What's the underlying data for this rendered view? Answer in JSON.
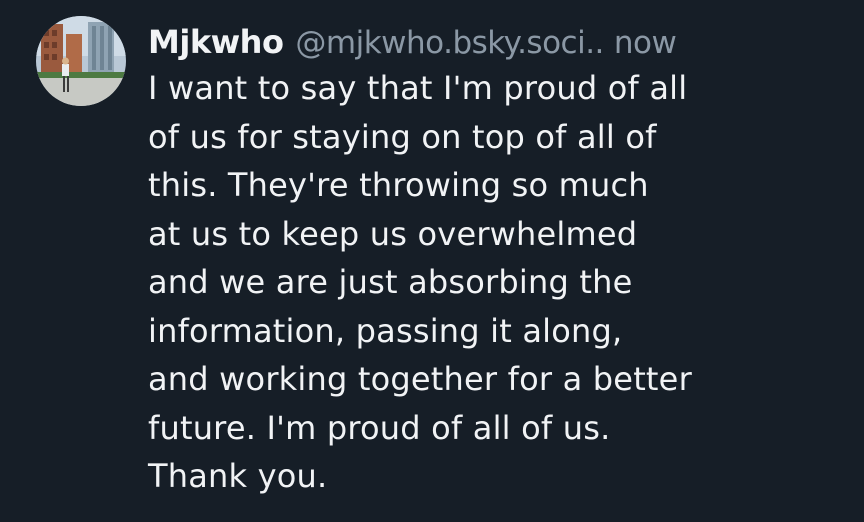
{
  "post": {
    "author": {
      "display_name": "Mjkwho",
      "handle": "@mjkwho.bsky.soci..",
      "avatar_icon": "street-photo-avatar"
    },
    "timestamp": "now",
    "text_lines": [
      "I want to say that I'm proud of all",
      "of us for staying on top of all of",
      "this. They're throwing so much",
      "at us to keep us overwhelmed",
      "and we are just absorbing the",
      "information, passing it along,",
      "and working together for a better",
      "future. I'm proud of all of us.",
      "Thank you."
    ]
  },
  "colors": {
    "background": "#161e27",
    "text": "#f1f3f5",
    "muted": "#8b98a5"
  }
}
